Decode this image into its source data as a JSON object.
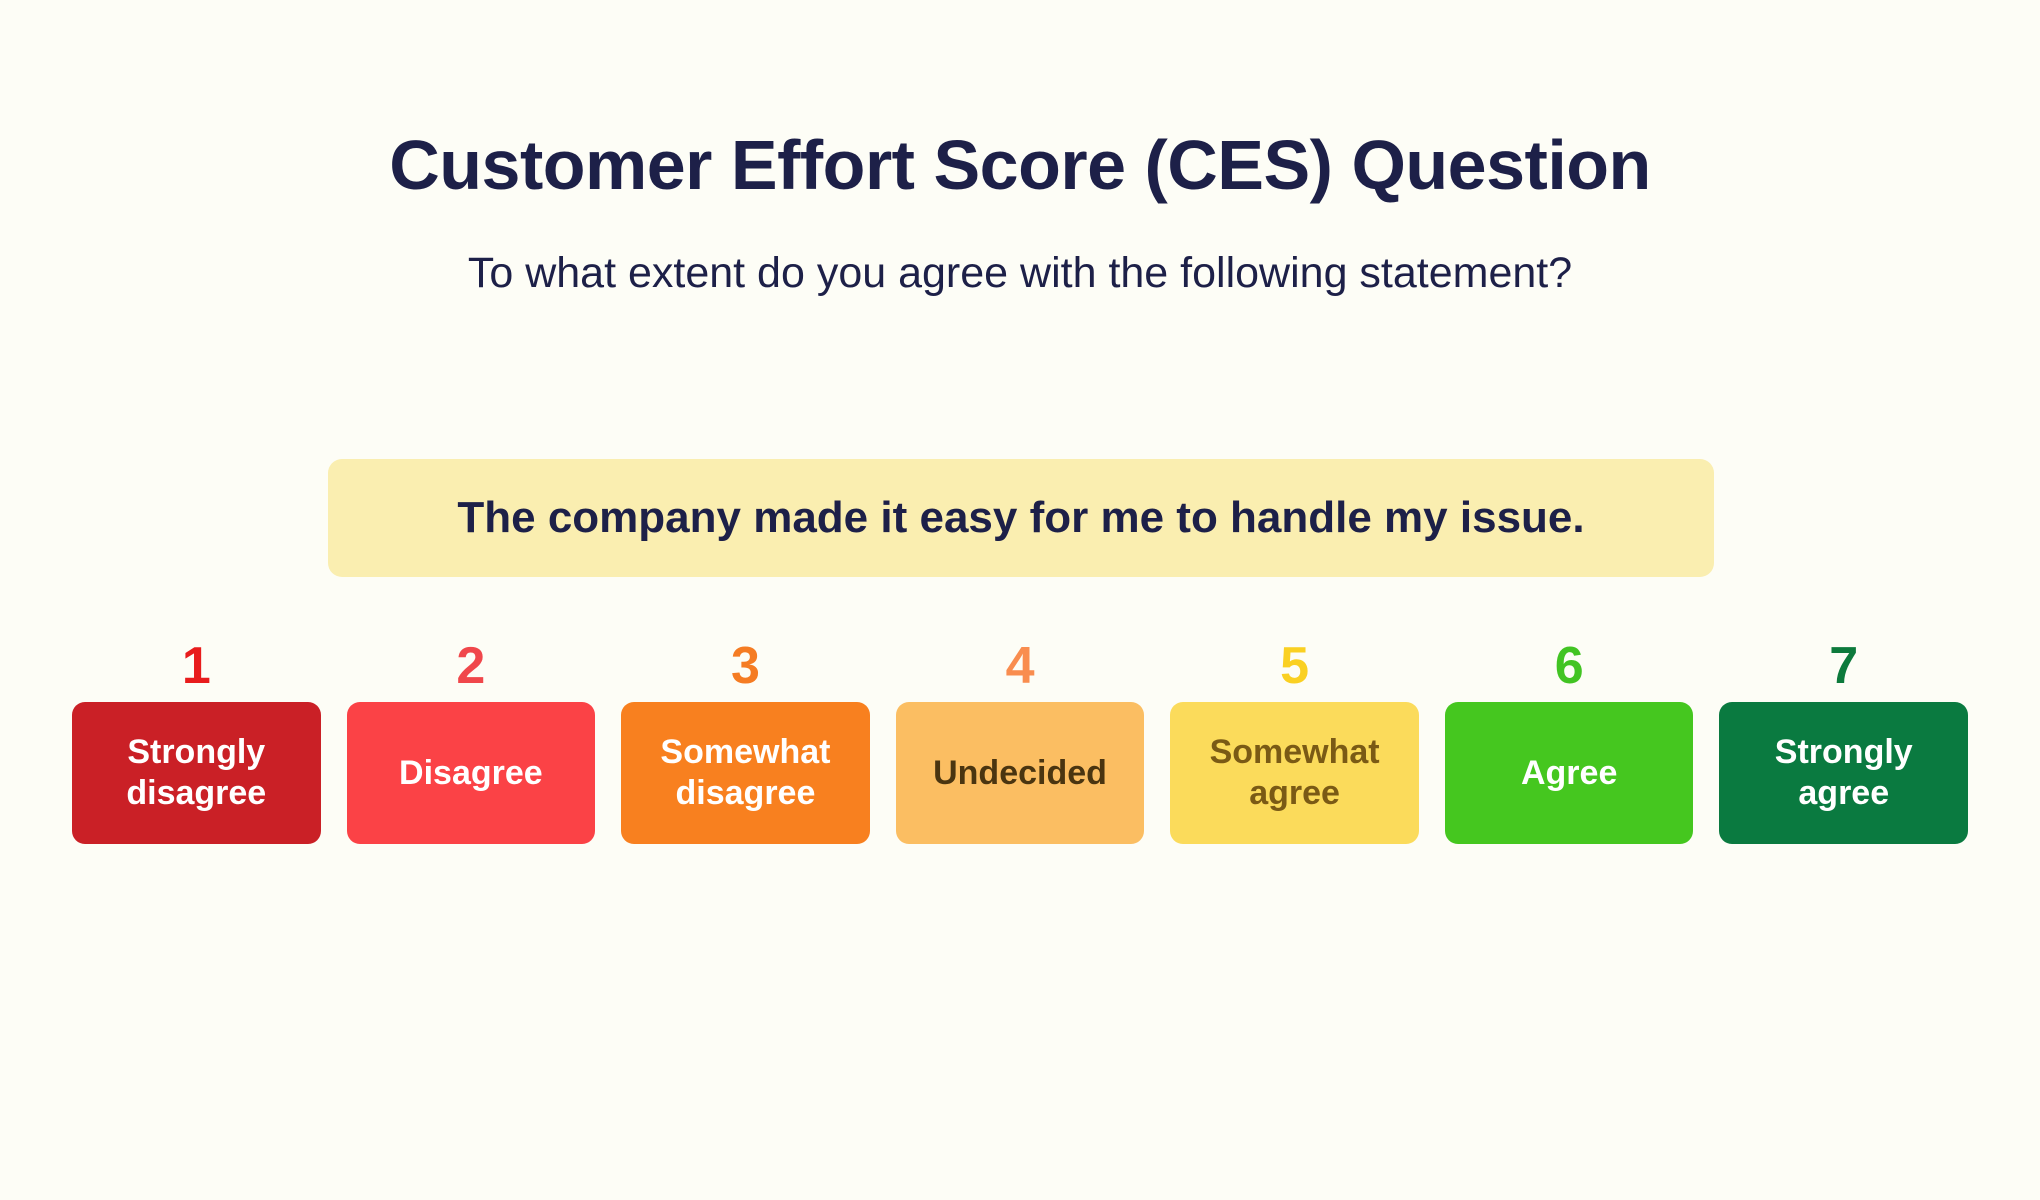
{
  "header": {
    "title": "Customer Effort Score (CES) Question",
    "subtitle": "To what extent do you agree with the following statement?",
    "title_color": "#1d2048"
  },
  "statement": {
    "text": "The company made it easy for me to handle my issue.",
    "background_color": "#faeeb0",
    "text_color": "#1d2048"
  },
  "scale": {
    "min": 1,
    "max": 7,
    "options": [
      {
        "number": "1",
        "label": "Strongly disagree",
        "number_color": "#e81c1c",
        "box_color": "#ca2026",
        "label_color": "#ffffff"
      },
      {
        "number": "2",
        "label": "Disagree",
        "number_color": "#f0474b",
        "box_color": "#fb4246",
        "label_color": "#ffffff"
      },
      {
        "number": "3",
        "label": "Somewhat disagree",
        "number_color": "#f57c23",
        "box_color": "#f8801f",
        "label_color": "#ffffff"
      },
      {
        "number": "4",
        "label": "Undecided",
        "number_color": "#f98d4f",
        "box_color": "#fbbe62",
        "label_color": "#4a3510"
      },
      {
        "number": "5",
        "label": "Somewhat agree",
        "number_color": "#fad022",
        "box_color": "#fbdb5b",
        "label_color": "#7a5a15"
      },
      {
        "number": "6",
        "label": "Agree",
        "number_color": "#42c423",
        "box_color": "#45c71f",
        "label_color": "#ffffff"
      },
      {
        "number": "7",
        "label": "Strongly agree",
        "number_color": "#0d7a3c",
        "box_color": "#0a7a40",
        "label_color": "#ffffff"
      }
    ]
  },
  "page": {
    "background_color": "#fdfdf6"
  }
}
